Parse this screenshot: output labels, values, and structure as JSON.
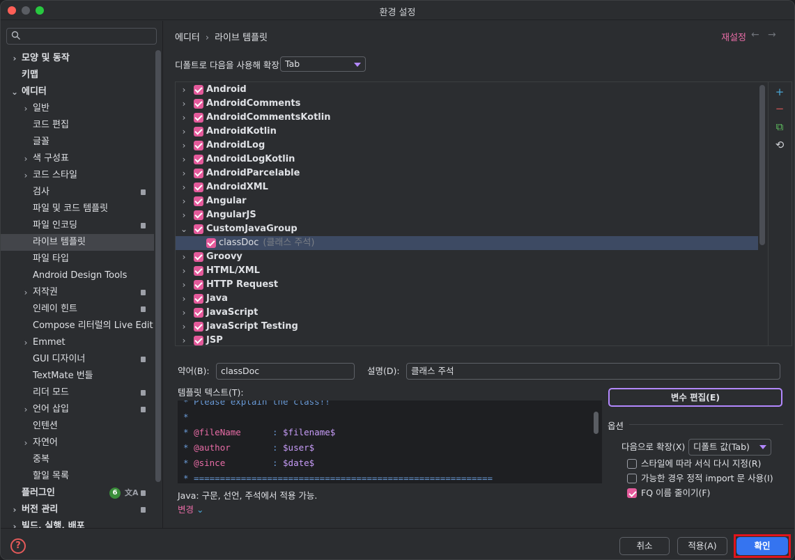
{
  "window": {
    "title": "환경 설정"
  },
  "sidebar": {
    "search_placeholder": "",
    "items": [
      {
        "label": "모양 및 동작",
        "level": 0,
        "chevron": "›",
        "bold": true
      },
      {
        "label": "키맵",
        "level": 0,
        "chevron": "",
        "bold": true
      },
      {
        "label": "에디터",
        "level": 0,
        "chevron": "⌄",
        "bold": true
      },
      {
        "label": "일반",
        "level": 1,
        "chevron": "›"
      },
      {
        "label": "코드 편집",
        "level": 1,
        "chevron": ""
      },
      {
        "label": "글꼴",
        "level": 1,
        "chevron": ""
      },
      {
        "label": "색 구성표",
        "level": 1,
        "chevron": "›"
      },
      {
        "label": "코드 스타일",
        "level": 1,
        "chevron": "›"
      },
      {
        "label": "검사",
        "level": 1,
        "chevron": "",
        "lock": true
      },
      {
        "label": "파일 및 코드 템플릿",
        "level": 1,
        "chevron": ""
      },
      {
        "label": "파일 인코딩",
        "level": 1,
        "chevron": "",
        "lock": true
      },
      {
        "label": "라이브 템플릿",
        "level": 1,
        "chevron": "",
        "selected": true
      },
      {
        "label": "파일 타입",
        "level": 1,
        "chevron": ""
      },
      {
        "label": "Android Design Tools",
        "level": 1,
        "chevron": ""
      },
      {
        "label": "저작권",
        "level": 1,
        "chevron": "›",
        "lock": true
      },
      {
        "label": "인레이 힌트",
        "level": 1,
        "chevron": "",
        "lock": true
      },
      {
        "label": "Compose 리터럴의 Live Edit",
        "level": 1,
        "chevron": ""
      },
      {
        "label": "Emmet",
        "level": 1,
        "chevron": "›"
      },
      {
        "label": "GUI 디자이너",
        "level": 1,
        "chevron": "",
        "lock": true
      },
      {
        "label": "TextMate 번들",
        "level": 1,
        "chevron": ""
      },
      {
        "label": "리더 모드",
        "level": 1,
        "chevron": "",
        "lock": true
      },
      {
        "label": "언어 삽입",
        "level": 1,
        "chevron": "›",
        "lock": true
      },
      {
        "label": "인텐션",
        "level": 1,
        "chevron": ""
      },
      {
        "label": "자연어",
        "level": 1,
        "chevron": "›"
      },
      {
        "label": "중복",
        "level": 1,
        "chevron": ""
      },
      {
        "label": "할일 목록",
        "level": 1,
        "chevron": ""
      },
      {
        "label": "플러그인",
        "level": 0,
        "chevron": "",
        "bold": true,
        "count": "6",
        "lock": true
      },
      {
        "label": "버전 관리",
        "level": 0,
        "chevron": "›",
        "bold": true,
        "lock": true
      },
      {
        "label": "빌드, 실행, 배포",
        "level": 0,
        "chevron": "›",
        "bold": true
      }
    ]
  },
  "header": {
    "breadcrumb": [
      "에디터",
      "라이브 템플릿"
    ],
    "breadcrumb_sep": "›",
    "reset_label": "재설정",
    "back_arrow": "←",
    "forward_arrow": "→"
  },
  "expand": {
    "label": "디폴트로 다음을 사용해 확장",
    "value": "Tab"
  },
  "tree": {
    "rows": [
      {
        "name": "Android",
        "chevron": "›"
      },
      {
        "name": "AndroidComments",
        "chevron": "›"
      },
      {
        "name": "AndroidCommentsKotlin",
        "chevron": "›"
      },
      {
        "name": "AndroidKotlin",
        "chevron": "›"
      },
      {
        "name": "AndroidLog",
        "chevron": "›"
      },
      {
        "name": "AndroidLogKotlin",
        "chevron": "›"
      },
      {
        "name": "AndroidParcelable",
        "chevron": "›"
      },
      {
        "name": "AndroidXML",
        "chevron": "›"
      },
      {
        "name": "Angular",
        "chevron": "›"
      },
      {
        "name": "AngularJS",
        "chevron": "›"
      },
      {
        "name": "CustomJavaGroup",
        "chevron": "⌄"
      },
      {
        "name": "classDoc",
        "chevron": "",
        "child": true,
        "selected": true,
        "desc": "(클래스 주석)"
      },
      {
        "name": "Groovy",
        "chevron": "›"
      },
      {
        "name": "HTML/XML",
        "chevron": "›"
      },
      {
        "name": "HTTP Request",
        "chevron": "›"
      },
      {
        "name": "Java",
        "chevron": "›"
      },
      {
        "name": "JavaScript",
        "chevron": "›"
      },
      {
        "name": "JavaScript Testing",
        "chevron": "›"
      },
      {
        "name": "JSP",
        "chevron": "›"
      }
    ],
    "tools": {
      "add": "+",
      "remove": "−",
      "copy": "⧉",
      "restore": "⟲"
    }
  },
  "form": {
    "abbrev_label": "약어(B):",
    "abbrev_value": "classDoc",
    "desc_label": "설명(D):",
    "desc_value": "클래스 주석",
    "template_label": "템플릿 텍스트(T):",
    "edit_vars_label": "변수 편집(E)",
    "applicable_text": "Java: 구문, 선언, 주석에서 적용 가능.",
    "change_label": "변경",
    "change_chevron": "⌄"
  },
  "editor": {
    "lines": [
      {
        "prefix": "* Please explain the class!!",
        "tag": "",
        "mid": "",
        "var": ""
      },
      {
        "prefix": "*",
        "tag": "",
        "mid": "",
        "var": ""
      },
      {
        "prefix": "* ",
        "tag": "@fileName",
        "mid": "      : ",
        "var": "$filename$"
      },
      {
        "prefix": "* ",
        "tag": "@author",
        "mid": "        : ",
        "var": "$user$"
      },
      {
        "prefix": "* ",
        "tag": "@since",
        "mid": "         : ",
        "var": "$date$"
      },
      {
        "prefix": "* =========================================================",
        "tag": "",
        "mid": "",
        "var": ""
      }
    ]
  },
  "options": {
    "title": "옵션",
    "expand_label": "다음으로 확장(X)",
    "expand_value": "디폴트 값(Tab)",
    "checks": [
      {
        "label": "스타일에 따라 서식 다시 지정(R)",
        "checked": false
      },
      {
        "label": "가능한 경우 정적 import 문 사용(I)",
        "checked": false
      },
      {
        "label": "FQ 이름 줄이기(F)",
        "checked": true
      }
    ]
  },
  "footer": {
    "help": "?",
    "cancel": "취소",
    "apply": "적용(A)",
    "ok": "확인"
  },
  "colors": {
    "accent": "#e45a9b",
    "primary_button": "#3574f0",
    "highlight_box": "#e0141c",
    "selection": "#3d4a63"
  }
}
